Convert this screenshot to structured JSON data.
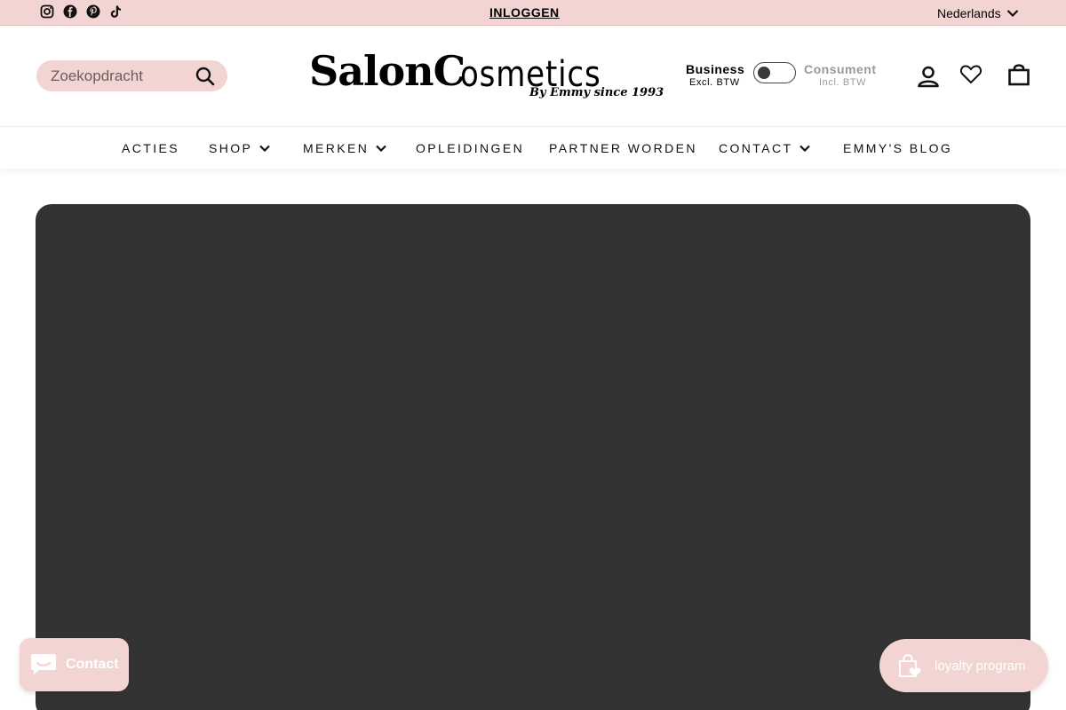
{
  "topbar": {
    "social_icons": [
      "instagram-icon",
      "facebook-icon",
      "pinterest-icon",
      "tiktok-icon"
    ],
    "login_label": "INLOGGEN",
    "language": "Nederlands"
  },
  "header": {
    "search": {
      "placeholder": "Zoekopdracht"
    },
    "logo": {
      "part1": "SalonC",
      "part2": "osmetics",
      "tagline": "By Emmy since 1993"
    },
    "price_toggle": {
      "business_label": "Business",
      "business_sub": "Excl. BTW",
      "consumer_label": "Consument",
      "consumer_sub": "Incl. BTW",
      "selected": "Business"
    },
    "icons": [
      "account-icon",
      "wishlist-heart-icon",
      "cart-bag-icon"
    ]
  },
  "nav": {
    "items": [
      {
        "label": "ACTIES",
        "dropdown": false
      },
      {
        "label": "SHOP",
        "dropdown": true
      },
      {
        "label": "MERKEN",
        "dropdown": true
      },
      {
        "label": "OPLEIDINGEN",
        "dropdown": false
      },
      {
        "label": "PARTNER WORDEN",
        "dropdown": false
      },
      {
        "label": "CONTACT",
        "dropdown": true
      },
      {
        "label": "EMMY'S BLOG",
        "dropdown": false
      }
    ]
  },
  "hero": {
    "background_color": "#333333"
  },
  "floating": {
    "chat_label": "Contact",
    "loyalty_label": "loyalty program"
  },
  "colors": {
    "accent_pink": "#f2d4d2",
    "text": "#000000"
  }
}
